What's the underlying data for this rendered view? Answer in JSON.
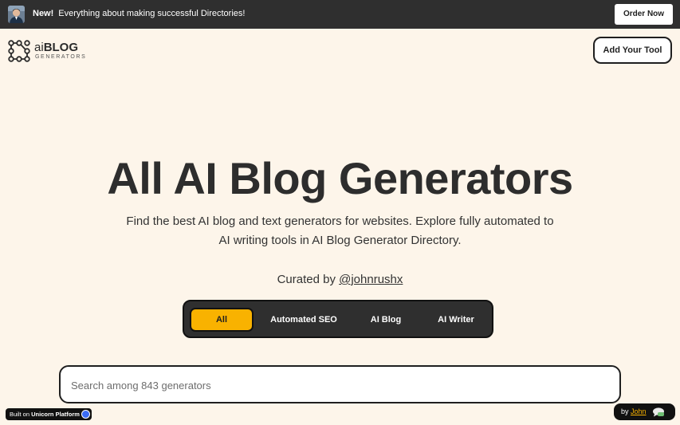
{
  "banner": {
    "new_label": "New!",
    "message": "Everything about making successful Directories!",
    "order_button": "Order Now"
  },
  "header": {
    "logo_prefix": "ai",
    "logo_main": "BLOG",
    "logo_sub": "GENERATORS",
    "add_tool_button": "Add Your Tool"
  },
  "hero": {
    "title": "All AI Blog Generators",
    "subtitle_line1": "Find the best AI blog and text generators for websites. Explore fully automated to",
    "subtitle_line2": "AI writing tools in AI Blog Generator Directory.",
    "curated_prefix": "Curated by ",
    "curated_handle": "@johnrushx"
  },
  "tabs": [
    {
      "label": "All",
      "active": true
    },
    {
      "label": "Automated SEO",
      "active": false
    },
    {
      "label": "AI Blog",
      "active": false
    },
    {
      "label": "AI Writer",
      "active": false
    }
  ],
  "search": {
    "placeholder": "Search among 843 generators",
    "value": ""
  },
  "badges": {
    "built_prefix": "Built on ",
    "built_platform": "Unicorn Platform",
    "by_prefix": "by ",
    "by_name": "John"
  },
  "colors": {
    "background": "#fdf5ea",
    "banner": "#2f2f2f",
    "accent": "#f9b200",
    "text": "#2d2d2d"
  },
  "icons": [
    "avatar",
    "logo-mark-icon",
    "unicorn-icon",
    "chat-icon"
  ]
}
